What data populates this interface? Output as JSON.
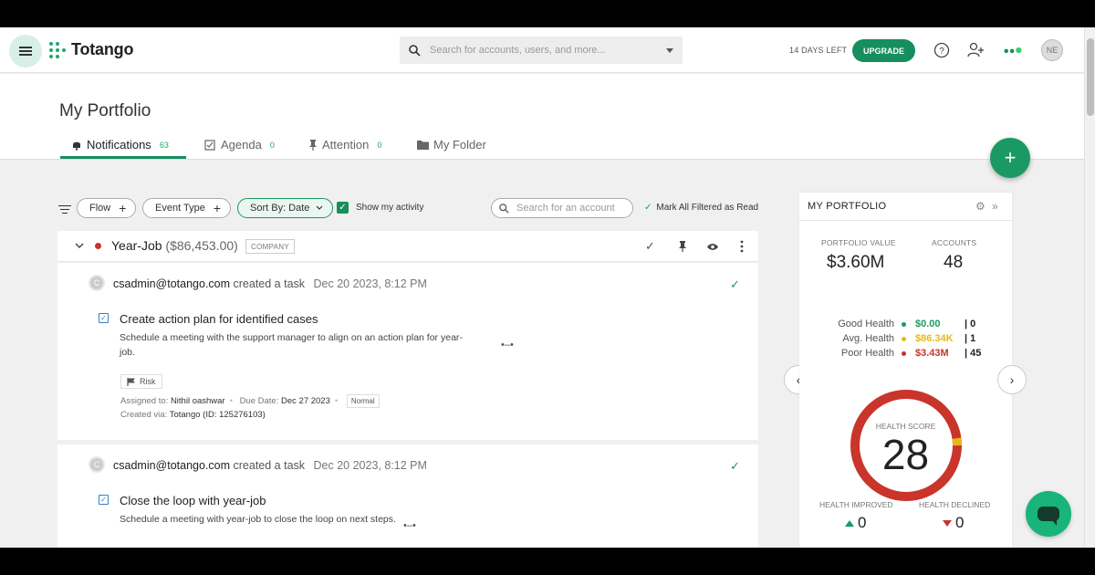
{
  "header": {
    "app_name": "Totango",
    "search_placeholder": "Search for accounts, users, and more...",
    "days_left": "14 DAYS LEFT",
    "upgrade_label": "UPGRADE",
    "avatar_initials": "NE"
  },
  "page": {
    "title": "My Portfolio",
    "tabs": [
      {
        "label": "Notifications",
        "count": "63",
        "icon": "bell-icon"
      },
      {
        "label": "Agenda",
        "count": "0",
        "icon": "checklist-icon"
      },
      {
        "label": "Attention",
        "count": "0",
        "icon": "pin-icon"
      },
      {
        "label": "My Folder",
        "count": "",
        "icon": "folder-icon"
      }
    ],
    "fab": "+"
  },
  "filters": {
    "flow": "Flow",
    "event_type": "Event Type",
    "sort": "Sort By: Date",
    "show_activity": "Show my activity",
    "account_search_placeholder": "Search for an account",
    "mark_all": "Mark All Filtered as Read"
  },
  "feed": {
    "group": {
      "name": "Year-Job",
      "amount": "($86,453.00)",
      "badge": "COMPANY",
      "status_color": "#c9342b"
    },
    "items": [
      {
        "avatar": "C",
        "user": "csadmin@totango.com",
        "action": "created a task",
        "date": "Dec 20 2023, 8:12 PM",
        "title": "Create action plan for identified cases",
        "description": "Schedule a meeting with the support manager to align on an action plan for year-job.",
        "tag": "Risk",
        "assigned_label": "Assigned to:",
        "assigned_to": "Nithil oashwar",
        "due_label": "Due Date:",
        "due_date": "Dec 27 2023",
        "priority": "Normal",
        "created_label": "Created via:",
        "created_via": "Totango",
        "id": "(ID: 125276103)"
      },
      {
        "avatar": "C",
        "user": "csadmin@totango.com",
        "action": "created a task",
        "date": "Dec 20 2023, 8:12 PM",
        "title": "Close the loop with year-job",
        "description": "Schedule a meeting with year-job to close the loop on next steps."
      }
    ]
  },
  "portfolio": {
    "title": "MY PORTFOLIO",
    "value_label": "PORTFOLIO VALUE",
    "value": "$3.60M",
    "accounts_label": "ACCOUNTS",
    "accounts": "48",
    "health_rows": [
      {
        "label": "Good Health",
        "value": "$0.00",
        "count": "| 0",
        "color": "#1a9964"
      },
      {
        "label": "Avg. Health",
        "value": "$86.34K",
        "count": "| 1",
        "color": "#e8b818"
      },
      {
        "label": "Poor Health",
        "value": "$3.43M",
        "count": "| 45",
        "color": "#c9342b"
      }
    ],
    "health_score_label": "HEALTH SCORE",
    "health_score": "28",
    "improved_label": "HEALTH IMPROVED",
    "improved": "0",
    "declined_label": "HEALTH DECLINED",
    "declined": "0"
  },
  "colors": {
    "accent": "#168e5e",
    "poor": "#c9342b",
    "avg": "#e8b818"
  }
}
